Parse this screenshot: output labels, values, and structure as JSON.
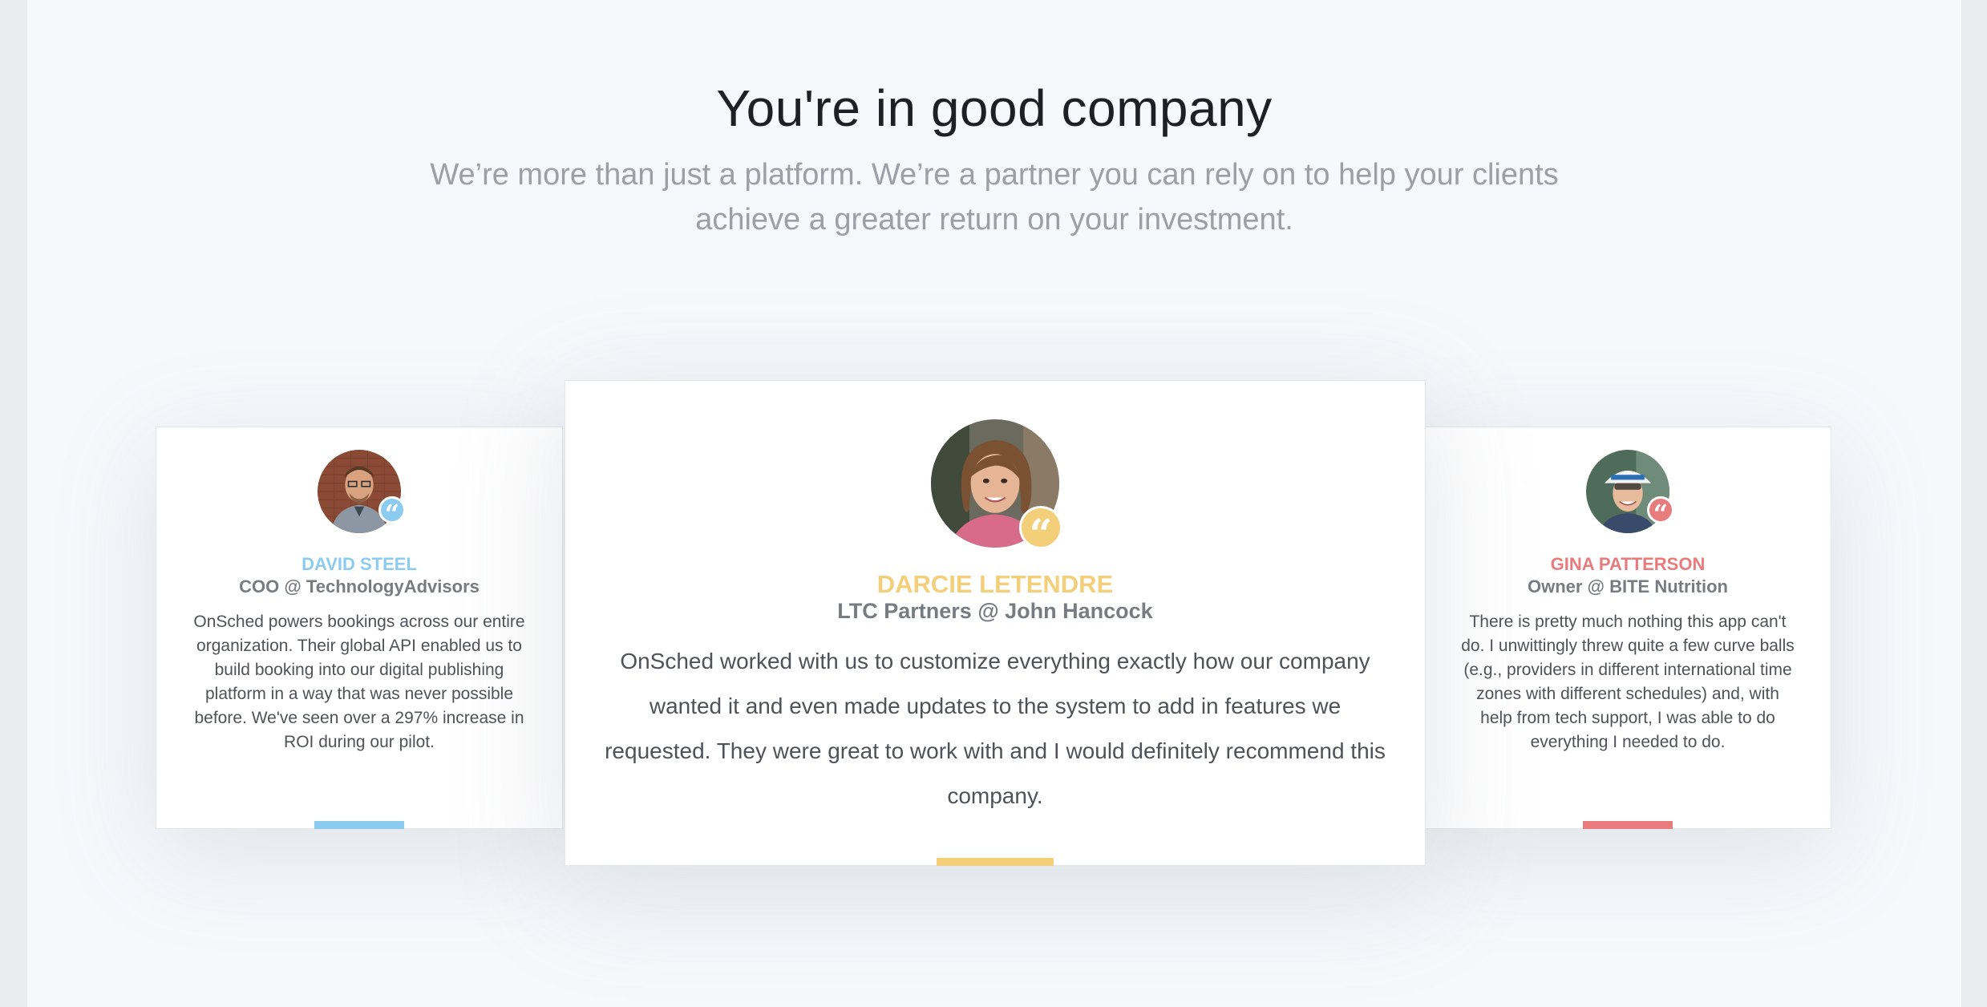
{
  "section": {
    "title": "You're in good company",
    "subtitle": "We’re more than just a platform. We’re a partner you can rely on to help your clients achieve a greater return on your investment."
  },
  "testimonials": [
    {
      "name": "DAVID STEEL",
      "role": "COO @ TechnologyAdvisors",
      "quote": "OnSched powers bookings across our entire organization. Their global API enabled us to build booking into our digital publishing platform in a way that was never possible before. We've seen over a 297% increase in ROI during our pilot.",
      "accent": "#8ccbf0",
      "badge_icon": "quote-icon"
    },
    {
      "name": "DARCIE LETENDRE",
      "role": "LTC Partners @ John Hancock",
      "quote": "OnSched worked with us to customize everything exactly how our company wanted it and even made updates to the system to add in features we requested. They were great to work with and I would definitely recommend this company.",
      "accent": "#f4cf7a",
      "badge_icon": "quote-icon"
    },
    {
      "name": "GINA PATTERSON",
      "role": "Owner @ BITE Nutrition",
      "quote": "There is pretty much nothing this app can't do. I unwittingly threw quite a few curve balls (e.g., providers in different international time zones with different schedules) and, with help from tech support, I was able to do everything I needed to do.",
      "accent": "#e87b7b",
      "badge_icon": "quote-icon"
    }
  ]
}
